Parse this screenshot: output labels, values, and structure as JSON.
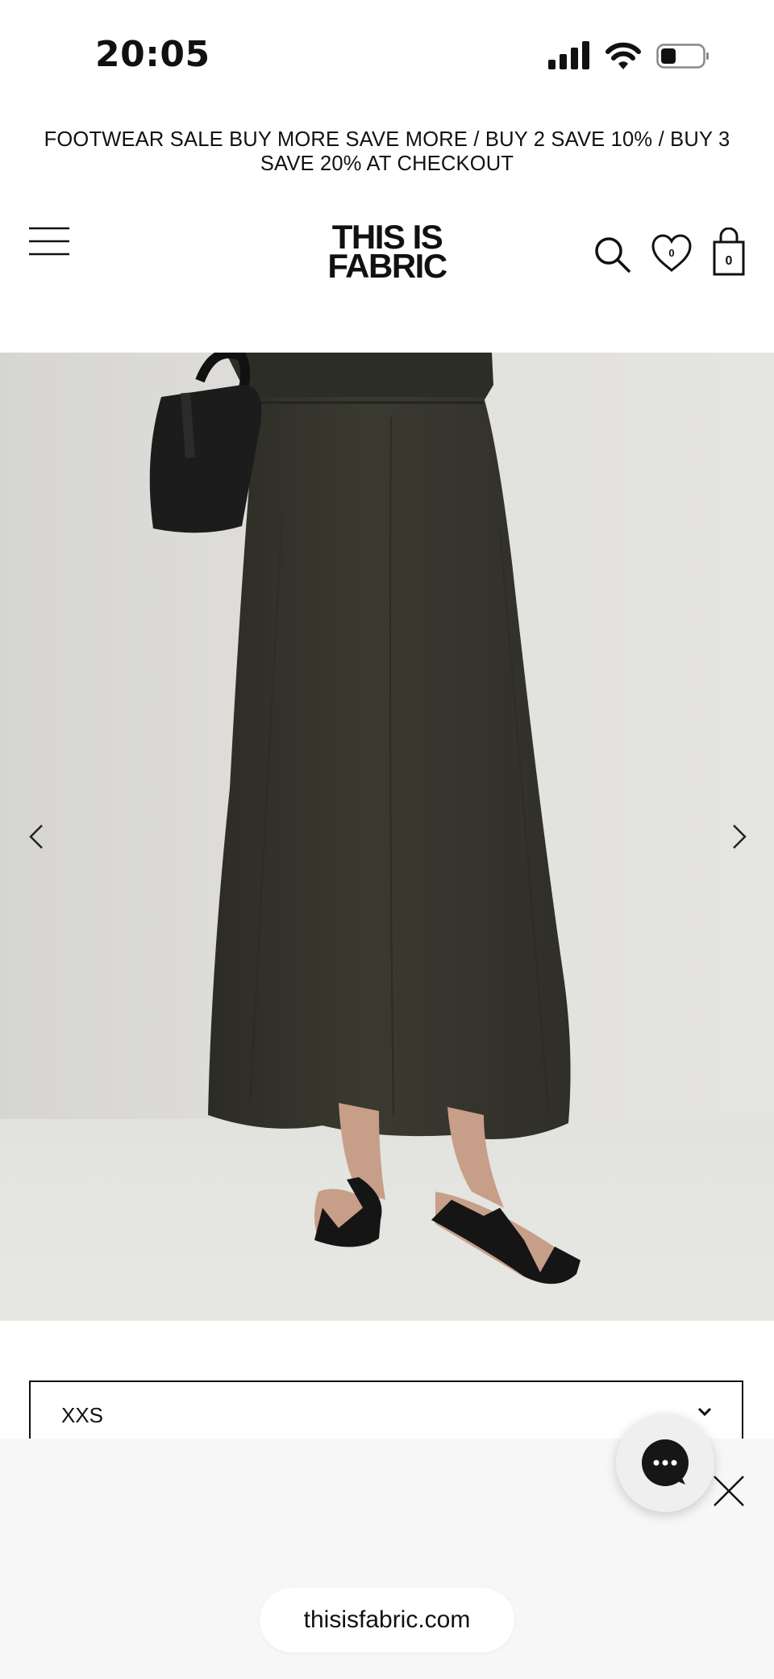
{
  "status_bar": {
    "time": "20:05",
    "icons": [
      "signal-icon",
      "wifi-icon",
      "battery-icon"
    ]
  },
  "promo_banner": {
    "text": "FOOTWEAR SALE BUY MORE SAVE MORE / BUY 2 SAVE 10% / BUY 3 SAVE 20% AT CHECKOUT"
  },
  "header": {
    "logo_line1": "THIS IS",
    "logo_line2": "FABRIC",
    "icons": [
      "menu-icon",
      "search-icon",
      "heart-icon",
      "bag-icon"
    ],
    "wishlist_count": "0",
    "cart_count": "0"
  },
  "product": {
    "image_subject": "model wearing long dark olive maxi skirt with black sandals and woven bag",
    "size_selected": "XXS"
  },
  "browser": {
    "url": "thisisfabric.com"
  },
  "colors": {
    "text": "#111111",
    "skirt": "#34342c",
    "backdrop": "#e0dfdb",
    "panel": "#f7f7f7"
  }
}
